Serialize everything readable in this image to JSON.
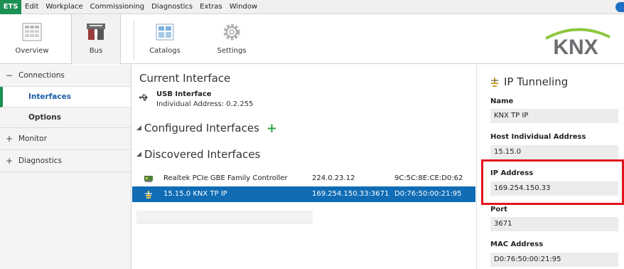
{
  "menubar": {
    "app": "ETS",
    "items": [
      "Edit",
      "Workplace",
      "Commissioning",
      "Diagnostics",
      "Extras",
      "Window"
    ]
  },
  "ribbon": {
    "overview": "Overview",
    "bus": "Bus",
    "catalogs": "Catalogs",
    "settings": "Settings",
    "logo": "KNX"
  },
  "nav": {
    "connections": "Connections",
    "interfaces": "Interfaces",
    "options": "Options",
    "monitor": "Monitor",
    "diagnostics": "Diagnostics",
    "expanded_symbol": "−",
    "collapsed_symbol": "+"
  },
  "main": {
    "current_title": "Current Interface",
    "current_name": "USB Interface",
    "current_address": "Individual Address: 0.2.255",
    "configured_title": "Configured Interfaces",
    "add_symbol": "+",
    "discovered_title": "Discovered Interfaces",
    "rows": [
      {
        "name": "Realtek PCIe GBE Family Controller",
        "ip": "224.0.23.12",
        "mac": "9C:5C:8E:CE:D0:62",
        "selected": false
      },
      {
        "name": "15.15.0  KNX TP IP",
        "ip": "169.254.150.33:3671",
        "mac": "D0:76:50:00:21:95",
        "selected": true
      }
    ]
  },
  "props": {
    "title": "IP Tunneling",
    "name_label": "Name",
    "name_value": "KNX TP IP",
    "host_label": "Host Individual Address",
    "host_value": "15.15.0",
    "ip_label": "IP Address",
    "ip_value": "169.254.150.33",
    "port_label": "Port",
    "port_value": "3671",
    "mac_label": "MAC Address",
    "mac_value": "D0:76:50:00:21:95"
  },
  "colors": {
    "ets_green": "#1c8f54",
    "selection_blue": "#0f6cb5",
    "highlight_red": "#e0161c",
    "knx_green": "#8dc63f",
    "knx_grey": "#6d6e71"
  }
}
